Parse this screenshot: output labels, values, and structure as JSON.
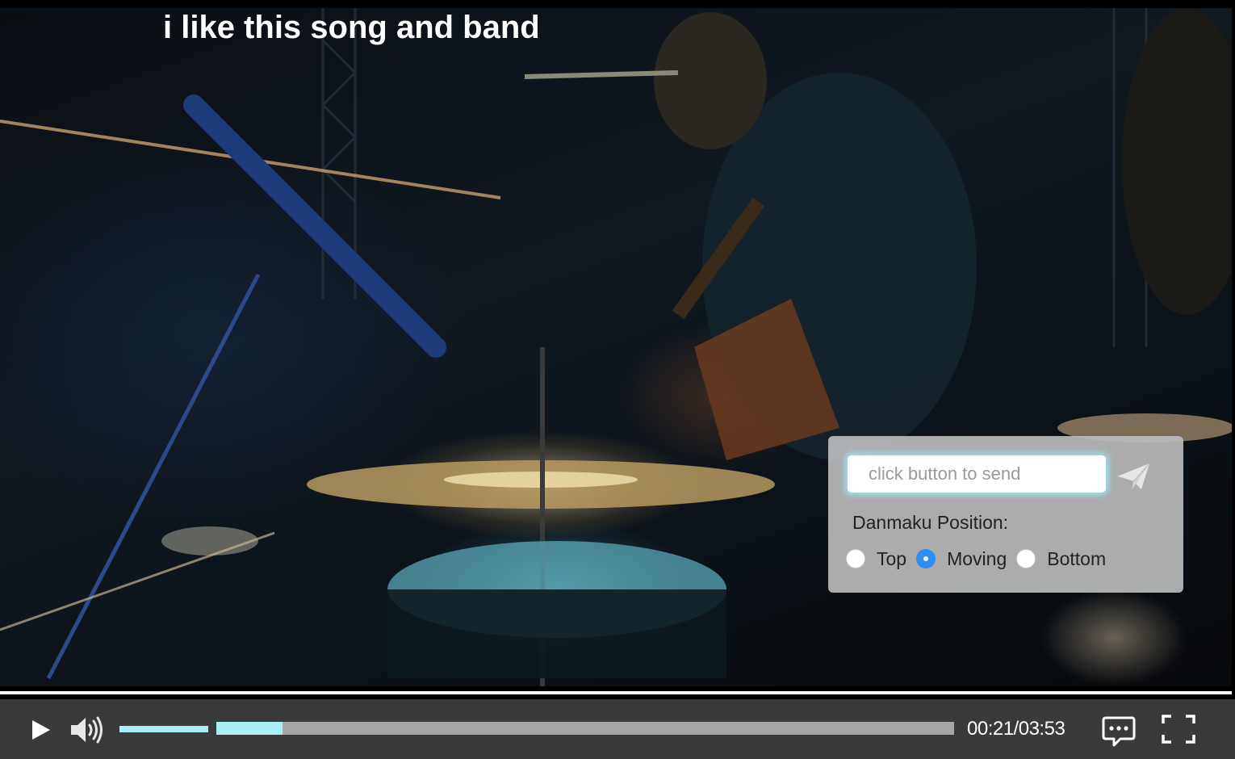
{
  "video": {
    "danmaku_comment": "i like this song and band"
  },
  "danmaku_panel": {
    "input_placeholder": "click button to send",
    "send_icon": "paper-plane-icon",
    "position_label": "Danmaku Position:",
    "position_options": [
      {
        "label": "Top",
        "checked": false
      },
      {
        "label": "Moving",
        "checked": true
      },
      {
        "label": "Bottom",
        "checked": false
      }
    ],
    "selected_position": "Moving"
  },
  "controls": {
    "play_icon": "play-icon",
    "volume_icon": "volume-icon",
    "volume_level": 1.0,
    "progress_fraction": 0.09,
    "time_readout": "00:21/03:53",
    "danmaku_toggle_icon": "chat-bubble-icon",
    "fullscreen_icon": "fullscreen-icon",
    "accent_color": "#a8f0f5",
    "track_color": "#a6a6a6",
    "bar_color": "#3a3a3a",
    "radio_checked_color": "#2f8df5"
  }
}
